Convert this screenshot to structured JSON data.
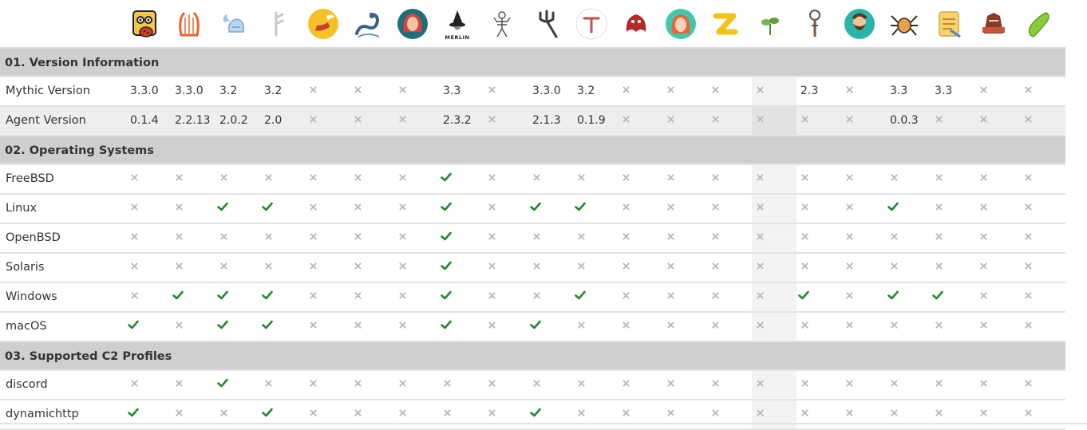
{
  "agents": [
    {
      "icon": "owl-mascot-icon"
    },
    {
      "icon": "lyre-harp-icon"
    },
    {
      "icon": "winged-helmet-icon"
    },
    {
      "icon": "rune-glyph-icon"
    },
    {
      "icon": "winged-sandal-icon"
    },
    {
      "icon": "sea-serpent-icon"
    },
    {
      "icon": "red-haired-woman-icon"
    },
    {
      "icon": "merlin-wizard-icon",
      "caption": "MERLIN"
    },
    {
      "icon": "skeleton-figure-icon"
    },
    {
      "icon": "trident-icon"
    },
    {
      "icon": "tau-symbol-icon"
    },
    {
      "icon": "red-dragon-icon"
    },
    {
      "icon": "red-haired-figure-icon"
    },
    {
      "icon": "yellow-z-icon"
    },
    {
      "icon": "plant-sprout-icon"
    },
    {
      "icon": "staff-icon"
    },
    {
      "icon": "bearded-man-icon"
    },
    {
      "icon": "spider-icon"
    },
    {
      "icon": "scroll-package-icon"
    },
    {
      "icon": "armored-warrior-icon"
    },
    {
      "icon": "pickle-icon"
    }
  ],
  "sections": [
    {
      "title": "01. Version Information",
      "rows": [
        {
          "label": "Mythic Version",
          "cells": [
            "3.3.0",
            "3.3.0",
            "3.2",
            "3.2",
            "x",
            "x",
            "x",
            "3.3",
            "x",
            "3.3.0",
            "3.2",
            "x",
            "x",
            "x",
            "x",
            "2.3",
            "x",
            "3.3",
            "3.3",
            "x",
            "x"
          ]
        },
        {
          "label": "Agent Version",
          "cells": [
            "0.1.4",
            "2.2.13",
            "2.0.2",
            "2.0",
            "x",
            "x",
            "x",
            "2.3.2",
            "x",
            "2.1.3",
            "0.1.9",
            "x",
            "x",
            "x",
            "x",
            "x",
            "x",
            "0.0.3",
            "x",
            "x",
            "x"
          ]
        }
      ]
    },
    {
      "title": "02. Operating Systems",
      "rows": [
        {
          "label": "FreeBSD",
          "cells": [
            "x",
            "x",
            "x",
            "x",
            "x",
            "x",
            "x",
            "check",
            "x",
            "x",
            "x",
            "x",
            "x",
            "x",
            "x",
            "x",
            "x",
            "x",
            "x",
            "x",
            "x"
          ]
        },
        {
          "label": "Linux",
          "cells": [
            "x",
            "x",
            "check",
            "check",
            "x",
            "x",
            "x",
            "check",
            "x",
            "check",
            "check",
            "x",
            "x",
            "x",
            "x",
            "x",
            "x",
            "check",
            "x",
            "x",
            "x"
          ]
        },
        {
          "label": "OpenBSD",
          "cells": [
            "x",
            "x",
            "x",
            "x",
            "x",
            "x",
            "x",
            "check",
            "x",
            "x",
            "x",
            "x",
            "x",
            "x",
            "x",
            "x",
            "x",
            "x",
            "x",
            "x",
            "x"
          ]
        },
        {
          "label": "Solaris",
          "cells": [
            "x",
            "x",
            "x",
            "x",
            "x",
            "x",
            "x",
            "check",
            "x",
            "x",
            "x",
            "x",
            "x",
            "x",
            "x",
            "x",
            "x",
            "x",
            "x",
            "x",
            "x"
          ]
        },
        {
          "label": "Windows",
          "cells": [
            "x",
            "check",
            "check",
            "check",
            "x",
            "x",
            "x",
            "check",
            "x",
            "x",
            "check",
            "x",
            "x",
            "x",
            "x",
            "check",
            "x",
            "check",
            "check",
            "x",
            "x"
          ]
        },
        {
          "label": "macOS",
          "cells": [
            "check",
            "x",
            "check",
            "check",
            "x",
            "x",
            "x",
            "check",
            "x",
            "check",
            "x",
            "x",
            "x",
            "x",
            "x",
            "x",
            "x",
            "x",
            "x",
            "x",
            "x"
          ]
        }
      ]
    },
    {
      "title": "03. Supported C2 Profiles",
      "rows": [
        {
          "label": "discord",
          "cells": [
            "x",
            "x",
            "check",
            "x",
            "x",
            "x",
            "x",
            "x",
            "x",
            "x",
            "x",
            "x",
            "x",
            "x",
            "x",
            "x",
            "x",
            "x",
            "x",
            "x",
            "x"
          ]
        },
        {
          "label": "dynamichttp",
          "cells": [
            "check",
            "x",
            "x",
            "check",
            "x",
            "x",
            "x",
            "x",
            "x",
            "check",
            "x",
            "x",
            "x",
            "x",
            "x",
            "x",
            "x",
            "x",
            "x",
            "x",
            "x"
          ]
        }
      ]
    }
  ],
  "colors": {
    "check": "#1e8a2e",
    "x": "#b8b8b8",
    "section_bg": "#cfcfcf",
    "alt_row": "#eeeeee"
  }
}
